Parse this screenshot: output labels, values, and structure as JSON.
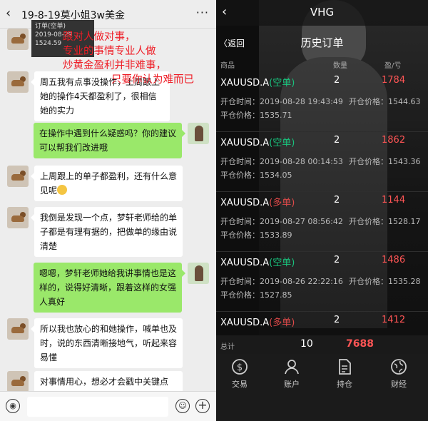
{
  "chat": {
    "title": "19-8-19莫小姐3w美金",
    "shared_card": {
      "line1": "订单(空单)",
      "line2": "2019-08-29 ...",
      "line3": "1524.59"
    },
    "messages": [
      {
        "side": "in",
        "text": "周五我有点事没操作，上周跟上她的操作4天都盈利了，很相信她的实力"
      },
      {
        "side": "out",
        "text": "在操作中遇到什么疑惑吗？你的建议可以帮我们改进哦"
      },
      {
        "side": "in",
        "text": "上周跟上的单子都盈利，还有什么意见呢"
      },
      {
        "side": "in",
        "text": "我倒是发现一个点，梦轩老师给的单子都是有理有据的，把做单的缘由说清楚"
      },
      {
        "side": "out",
        "text": "嗯嗯，梦轩老师她给我讲事情也是这样的，说得好清晰，跟着这样的女强人真好"
      },
      {
        "side": "in",
        "text": "所以我也放心的和她操作，喊单也及时，说的东西清晰接地气，听起来容易懂"
      },
      {
        "side": "in",
        "text": "对事情用心，想必才会戳中关键点"
      }
    ]
  },
  "overlay": {
    "lines": [
      "跟对人做对事，",
      "专业的事情专业人做",
      "炒黄金盈利并非难事，",
      "只要你认为难而已"
    ]
  },
  "app": {
    "title": "VHG",
    "return_label": "〈返回",
    "subtitle": "历史订单",
    "columns": {
      "product": "商品",
      "qty": "数量",
      "pnl": "盈/亏"
    },
    "open_time_label": "开仓时间：",
    "open_price_label": "开仓价格：",
    "close_price_label": "平仓价格：",
    "orders": [
      {
        "symbol": "XAUUSD.A",
        "side": "(空单)",
        "qty": "2",
        "pnl": "1784",
        "open_time": "2019-08-28 19:43:49",
        "open_price": "1544.63",
        "close_price": "1535.71"
      },
      {
        "symbol": "XAUUSD.A",
        "side": "(空单)",
        "qty": "2",
        "pnl": "1862",
        "open_time": "2019-08-28 00:14:53",
        "open_price": "1543.36",
        "close_price": "1534.05"
      },
      {
        "symbol": "XAUUSD.A",
        "side": "(多单)",
        "qty": "2",
        "pnl": "1144",
        "open_time": "2019-08-27 08:56:42",
        "open_price": "1528.17",
        "close_price": "1533.89"
      },
      {
        "symbol": "XAUUSD.A",
        "side": "(空单)",
        "qty": "2",
        "pnl": "1486",
        "open_time": "2019-08-26 22:22:16",
        "open_price": "1535.28",
        "close_price": "1527.85"
      },
      {
        "symbol": "XAUUSD.A",
        "side": "(多单)",
        "qty": "2",
        "pnl": "1412",
        "open_time": "",
        "open_price": "",
        "close_price": ""
      }
    ],
    "summary": {
      "label": "总计",
      "qty": "10",
      "pnl": "7688"
    },
    "tabs": [
      {
        "label": "交易",
        "icon": "dollar-coin-icon"
      },
      {
        "label": "账户",
        "icon": "person-icon"
      },
      {
        "label": "持仓",
        "icon": "document-icon"
      },
      {
        "label": "财经",
        "icon": "globe-icon"
      }
    ],
    "colors": {
      "short": "#19c37d",
      "long": "#e04a4a",
      "profit": "#ff5555"
    }
  }
}
